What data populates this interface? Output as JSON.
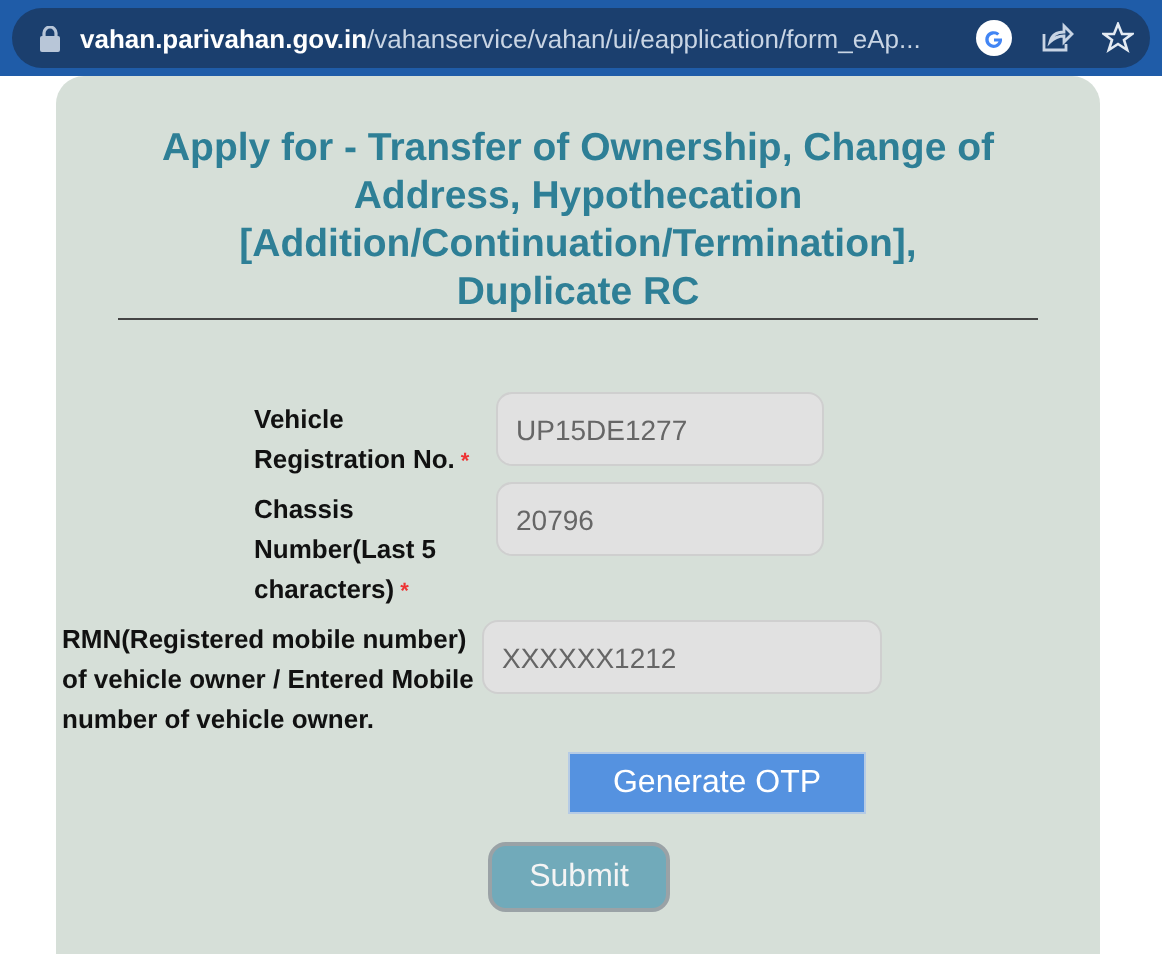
{
  "browser": {
    "url_domain": "vahan.parivahan.gov.in",
    "url_path": "/vahanservice/vahan/ui/eapplication/form_eAp..."
  },
  "form": {
    "title": "Apply for - Transfer of Ownership, Change of Address, Hypothecation [Addition/Continuation/Termination], Duplicate RC",
    "fields": [
      {
        "label": "Vehicle Registration No.",
        "required_mark": "*",
        "value": "UP15DE1277"
      },
      {
        "label": "Chassis Number(Last 5 characters)",
        "required_mark": "*",
        "value": "20796"
      },
      {
        "label": "RMN(Registered mobile number) of vehicle owner / Entered Mobile number of vehicle owner.",
        "value": "XXXXXX1212"
      }
    ],
    "otp_button": "Generate OTP",
    "submit_button": "Submit"
  }
}
